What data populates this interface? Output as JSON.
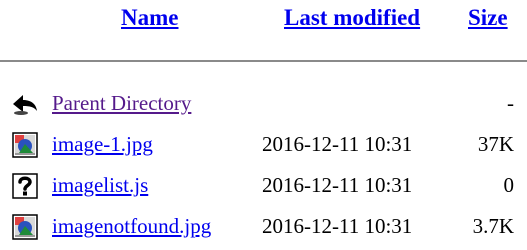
{
  "columns": {
    "name": "Name",
    "last_modified": "Last modified",
    "size": "Size"
  },
  "rows": [
    {
      "icon": "back-arrow-icon",
      "name": "Parent Directory",
      "modified": "",
      "size": "-"
    },
    {
      "icon": "image-file-icon",
      "name": "image-1.jpg",
      "modified": "2016-12-11 10:31",
      "size": "37K"
    },
    {
      "icon": "unknown-file-icon",
      "name": "imagelist.js",
      "modified": "2016-12-11 10:31",
      "size": "0"
    },
    {
      "icon": "image-file-icon",
      "name": "imagenotfound.jpg",
      "modified": "2016-12-11 10:31",
      "size": "3.7K"
    }
  ],
  "colors": {
    "link": "#0000ee",
    "visited_link": "#551a8b",
    "rule": "#8a8a8a"
  }
}
